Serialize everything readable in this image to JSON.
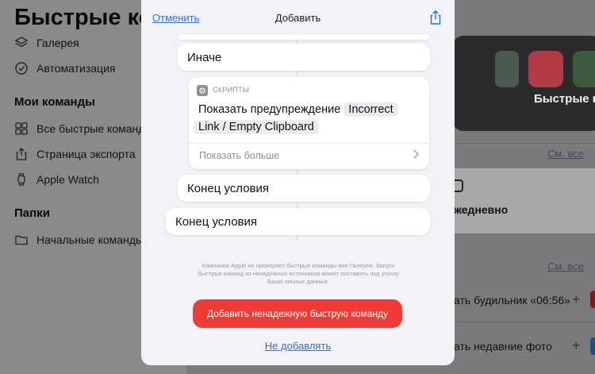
{
  "sidebar": {
    "title": "Быстрые команды",
    "top_items": [
      {
        "label": "Галерея",
        "icon": "layers-icon"
      },
      {
        "label": "Автоматизация",
        "icon": "clock-check-icon"
      }
    ],
    "my_commands_heading": "Мои команды",
    "my_items": [
      {
        "label": "Все быстрые команды",
        "icon": "grid-icon"
      },
      {
        "label": "Страница экспорта",
        "icon": "share-icon"
      },
      {
        "label": "Apple Watch",
        "icon": "watch-icon"
      }
    ],
    "folders_heading": "Папки",
    "folder_items": [
      {
        "label": "Начальные команды",
        "icon": "folder-icon"
      }
    ]
  },
  "background": {
    "tile_label": "Быстрые ко",
    "see_all_1": "См. все",
    "card_text": "жедневно",
    "see_all_2": "См. все",
    "row1": "ать будильник «06:56»",
    "row2": "ать недавние фото"
  },
  "sheet": {
    "cancel": "Отменить",
    "title": "Добавить",
    "else_block": "Иначе",
    "action": {
      "category": "СКРИПТЫ",
      "line1_prefix": "Показать предупреждение",
      "line1_token": "Incorrect",
      "line2_token": "Link / Empty Clipboard",
      "show_more": "Показать больше"
    },
    "end_if_inner": "Конец условия",
    "end_if_outer": "Конец условия",
    "disclaimer": "Компания Apple не проверяет быстрые команды вне Галереи. Запуск быстрых команд из ненадежных источников может поставить под угрозу Ваши личные данные.",
    "add_button": "Добавить ненадежную быструю команду",
    "dont_add": "Не добавлять"
  },
  "colors": {
    "accent_blue": "#2f6fd0",
    "danger_red": "#ef3b35",
    "sheet_bg": "#f2f2f7"
  }
}
